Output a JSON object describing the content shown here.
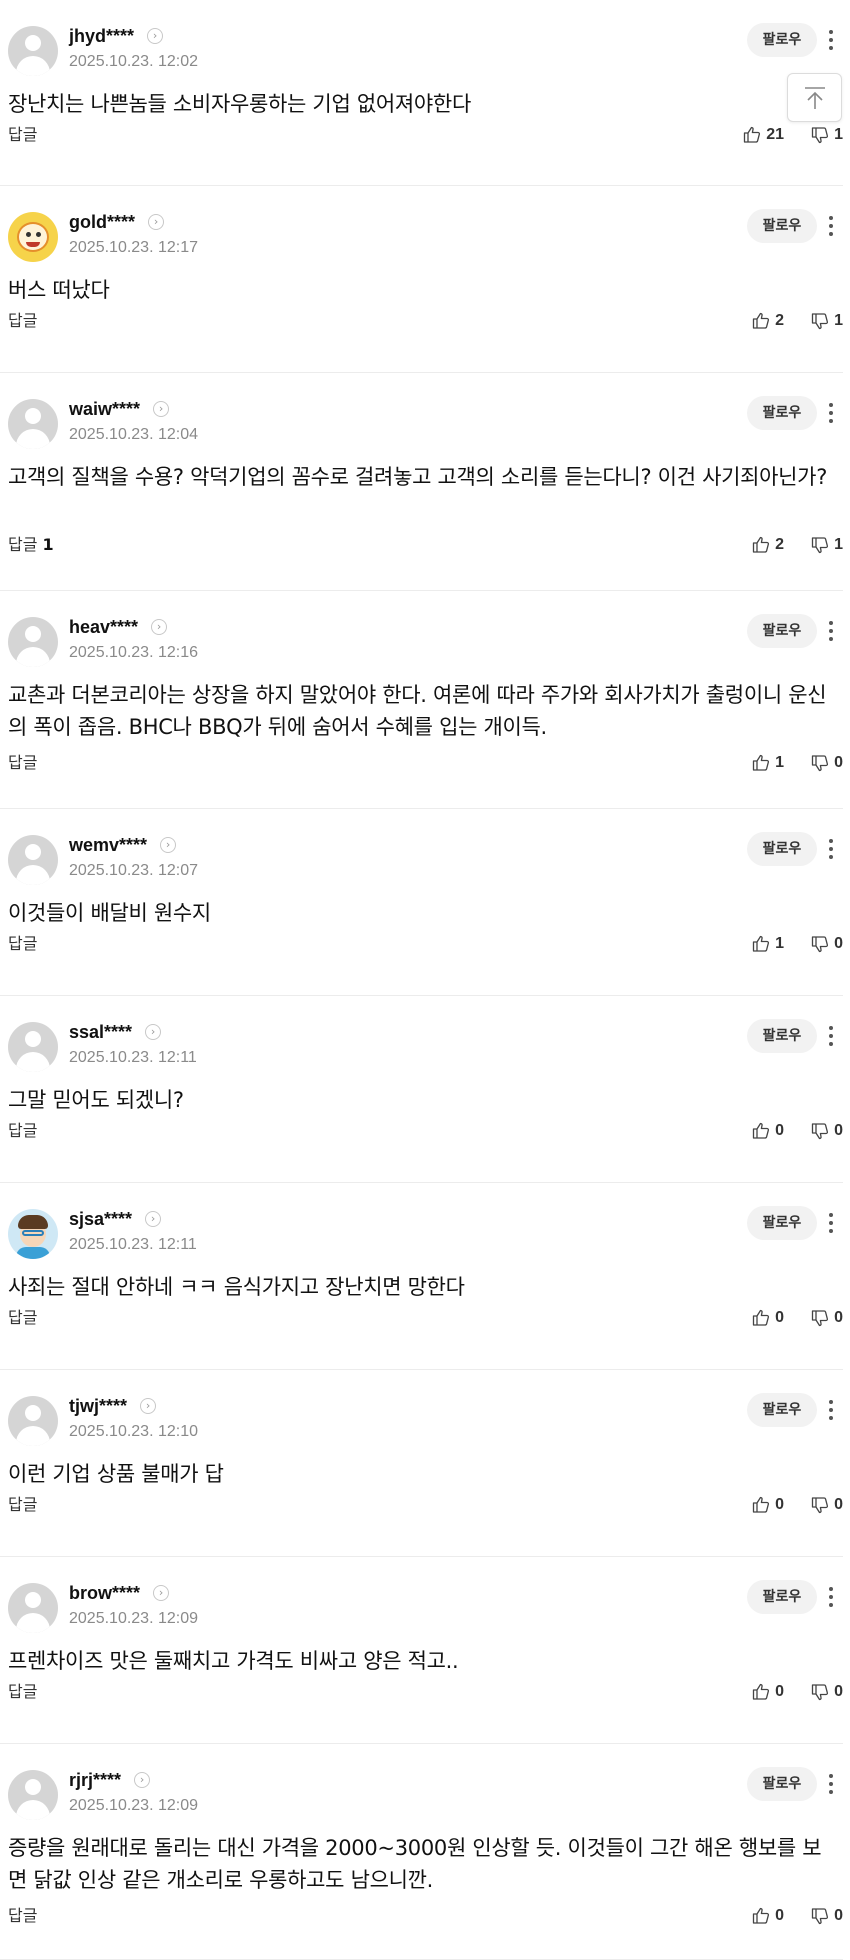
{
  "comments": [
    {
      "username": "jhyd****",
      "time": "2025.10.23. 12:02",
      "text": "장난치는 나쁜놈들 소비자우롱하는 기업 없어져야한다",
      "reply_label": "답글",
      "reply_count": "",
      "likes": "21",
      "dislikes": "1",
      "avatar": "default",
      "follow": "팔로우"
    },
    {
      "username": "gold****",
      "time": "2025.10.23. 12:17",
      "text": "버스 떠났다",
      "reply_label": "답글",
      "reply_count": "",
      "likes": "2",
      "dislikes": "1",
      "avatar": "gold",
      "follow": "팔로우"
    },
    {
      "username": "waiw****",
      "time": "2025.10.23. 12:04",
      "text": "고객의 질책을 수용? 악덕기업의 꼼수로 걸려놓고 고객의 소리를 듣는다니? 이건 사기죄아닌가?",
      "reply_label": "답글",
      "reply_count": "1",
      "likes": "2",
      "dislikes": "1",
      "avatar": "default",
      "follow": "팔로우"
    },
    {
      "username": "heav****",
      "time": "2025.10.23. 12:16",
      "text": "교촌과 더본코리아는 상장을 하지 말았어야 한다. 여론에 따라 주가와 회사가치가 출렁이니 운신의 폭이 좁음. BHC나 BBQ가 뒤에 숨어서 수혜를 입는 개이득.",
      "reply_label": "답글",
      "reply_count": "",
      "likes": "1",
      "dislikes": "0",
      "avatar": "default",
      "follow": "팔로우"
    },
    {
      "username": "wemv****",
      "time": "2025.10.23. 12:07",
      "text": "이것들이 배달비 원수지",
      "reply_label": "답글",
      "reply_count": "",
      "likes": "1",
      "dislikes": "0",
      "avatar": "default",
      "follow": "팔로우"
    },
    {
      "username": "ssal****",
      "time": "2025.10.23. 12:11",
      "text": "그말 믿어도 되겠니?",
      "reply_label": "답글",
      "reply_count": "",
      "likes": "0",
      "dislikes": "0",
      "avatar": "default",
      "follow": "팔로우"
    },
    {
      "username": "sjsa****",
      "time": "2025.10.23. 12:11",
      "text": "사죄는 절대 안하네 ㅋㅋ 음식가지고 장난치면 망한다",
      "reply_label": "답글",
      "reply_count": "",
      "likes": "0",
      "dislikes": "0",
      "avatar": "sjsa",
      "follow": "팔로우"
    },
    {
      "username": "tjwj****",
      "time": "2025.10.23. 12:10",
      "text": "이런 기업 상품 불매가 답",
      "reply_label": "답글",
      "reply_count": "",
      "likes": "0",
      "dislikes": "0",
      "avatar": "default",
      "follow": "팔로우"
    },
    {
      "username": "brow****",
      "time": "2025.10.23. 12:09",
      "text": "프렌차이즈 맛은 둘째치고 가격도 비싸고 양은 적고..",
      "reply_label": "답글",
      "reply_count": "",
      "likes": "0",
      "dislikes": "0",
      "avatar": "default",
      "follow": "팔로우"
    },
    {
      "username": "rjrj****",
      "time": "2025.10.23. 12:09",
      "text": "증량을 원래대로 돌리는 대신 가격을 2000~3000원 인상할 듯. 이것들이 그간 해온 행보를 보면 닭값 인상 같은 개소리로 우롱하고도 남으니깐.",
      "reply_label": "답글",
      "reply_count": "",
      "likes": "0",
      "dislikes": "0",
      "avatar": "default",
      "follow": "팔로우"
    }
  ],
  "icons": {
    "scroll_top": "arrow-up-to-top-icon",
    "like": "thumbs-up-icon",
    "dislike": "thumbs-down-icon",
    "more": "more-vertical-icon",
    "chevron": "chevron-right-icon"
  }
}
